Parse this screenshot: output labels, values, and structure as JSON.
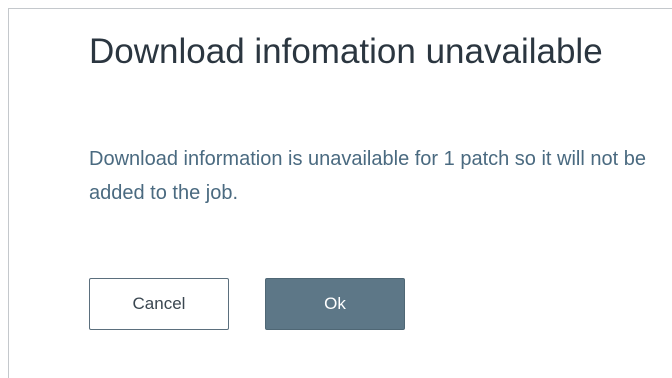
{
  "dialog": {
    "title": "Download infomation unavailable",
    "message": "Download information is unavailable for 1 patch so it will not be added to the job.",
    "cancel_label": "Cancel",
    "ok_label": "Ok"
  },
  "colors": {
    "title_text": "#2b3640",
    "message_text": "#4a6a80",
    "ok_button_bg": "#5d7787",
    "border": "#c4c8cc"
  }
}
